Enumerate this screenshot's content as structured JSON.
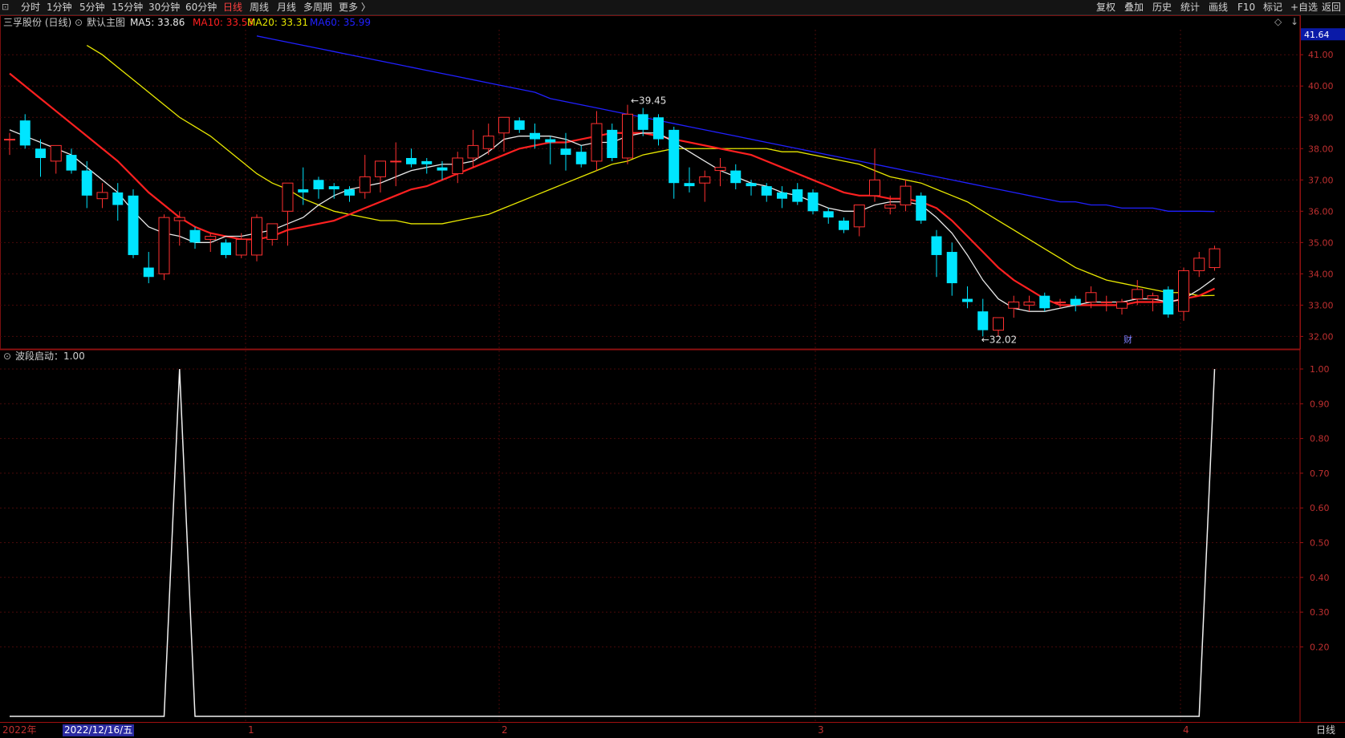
{
  "toolbar": {
    "left_items": [
      "分时",
      "1分钟",
      "5分钟",
      "15分钟",
      "30分钟",
      "60分钟",
      "日线",
      "周线",
      "月线",
      "多周期",
      "更多 〉"
    ],
    "active_item": "日线",
    "right_items": [
      "复权",
      "叠加",
      "历史",
      "统计",
      "画线",
      "F10",
      "标记",
      "+自选",
      "返回"
    ]
  },
  "main_panel": {
    "stock_title": "三孚股份 (日线)",
    "indicator_name": "默认主图",
    "ma": [
      {
        "label": "MA5: 33.86",
        "color": "#e8e8e8"
      },
      {
        "label": "MA10: 33.53",
        "color": "#ff2020"
      },
      {
        "label": "MA20: 33.31",
        "color": "#e8e800"
      },
      {
        "label": "MA60: 35.99",
        "color": "#2020ff"
      }
    ],
    "price_ticks": [
      "41.00",
      "40.00",
      "39.00",
      "38.00",
      "37.00",
      "36.00",
      "35.00",
      "34.00",
      "33.00",
      "32.00"
    ],
    "current_price_label": "41.64",
    "high_annotation": "39.45",
    "low_annotation": "32.02",
    "event_marker": "财",
    "right_icons": [
      "◇",
      "↓"
    ]
  },
  "sub_panel": {
    "indicator_label": "波段启动：1.00",
    "ticks": [
      "1.00",
      "0.90",
      "0.80",
      "0.70",
      "0.60",
      "0.50",
      "0.40",
      "0.30",
      "0.20"
    ]
  },
  "x_axis": {
    "year_label": "2022年",
    "cursor_date": "2022/12/16/五",
    "month_labels": [
      "1",
      "2",
      "3",
      "4"
    ],
    "period_label": "日线"
  },
  "colors": {
    "up": "#ff3030",
    "down": "#00e5ff",
    "grid": "#4a0a0a",
    "axis_text": "#c03030",
    "ma5": "#e8e8e8",
    "ma10": "#ff2020",
    "ma20": "#e8e800",
    "ma60": "#2020ff"
  },
  "chart_data": {
    "type": "candlestick",
    "y_range": [
      31.6,
      41.8
    ],
    "candles_ohlc": [
      [
        38.3,
        38.5,
        37.8,
        38.3
      ],
      [
        38.9,
        39.1,
        38.0,
        38.1
      ],
      [
        38.0,
        38.3,
        37.1,
        37.7
      ],
      [
        37.6,
        38.1,
        37.2,
        38.1
      ],
      [
        37.8,
        38.0,
        37.2,
        37.3
      ],
      [
        37.3,
        37.6,
        36.1,
        36.5
      ],
      [
        36.4,
        36.9,
        36.1,
        36.6
      ],
      [
        36.6,
        36.9,
        35.7,
        36.2
      ],
      [
        36.5,
        36.7,
        34.5,
        34.6
      ],
      [
        34.2,
        34.7,
        33.7,
        33.9
      ],
      [
        34.0,
        35.9,
        33.8,
        35.8
      ],
      [
        35.7,
        36.0,
        34.9,
        35.8
      ],
      [
        35.4,
        35.5,
        34.8,
        35.0
      ],
      [
        35.1,
        35.3,
        34.7,
        35.2
      ],
      [
        35.0,
        35.1,
        34.5,
        34.6
      ],
      [
        34.6,
        35.3,
        34.5,
        35.1
      ],
      [
        34.6,
        35.9,
        34.4,
        35.8
      ],
      [
        35.1,
        35.6,
        34.9,
        35.6
      ],
      [
        36.0,
        36.4,
        34.9,
        36.9
      ],
      [
        36.7,
        37.4,
        36.2,
        36.6
      ],
      [
        37.0,
        37.1,
        36.4,
        36.7
      ],
      [
        36.8,
        36.9,
        36.4,
        36.7
      ],
      [
        36.7,
        36.8,
        36.3,
        36.5
      ],
      [
        36.6,
        37.8,
        36.4,
        37.1
      ],
      [
        37.1,
        37.6,
        36.6,
        37.6
      ],
      [
        37.6,
        38.2,
        36.8,
        37.6
      ],
      [
        37.7,
        38.0,
        37.4,
        37.5
      ],
      [
        37.6,
        37.7,
        37.2,
        37.5
      ],
      [
        37.4,
        37.6,
        37.0,
        37.3
      ],
      [
        37.2,
        37.9,
        36.9,
        37.7
      ],
      [
        37.7,
        38.6,
        37.4,
        38.1
      ],
      [
        38.0,
        38.8,
        37.8,
        38.4
      ],
      [
        38.5,
        39.0,
        37.9,
        39.0
      ],
      [
        38.9,
        39.0,
        38.5,
        38.6
      ],
      [
        38.5,
        38.8,
        38.0,
        38.3
      ],
      [
        38.3,
        38.4,
        37.5,
        38.2
      ],
      [
        38.0,
        38.5,
        37.3,
        37.8
      ],
      [
        37.9,
        38.1,
        37.4,
        37.5
      ],
      [
        37.6,
        39.2,
        37.3,
        38.8
      ],
      [
        38.6,
        38.8,
        37.6,
        37.7
      ],
      [
        37.7,
        39.4,
        37.5,
        39.1
      ],
      [
        39.1,
        39.3,
        38.4,
        38.6
      ],
      [
        39.0,
        39.1,
        38.1,
        38.3
      ],
      [
        38.6,
        38.7,
        36.4,
        36.9
      ],
      [
        36.9,
        37.4,
        36.6,
        36.8
      ],
      [
        36.9,
        37.3,
        36.3,
        37.1
      ],
      [
        37.3,
        37.7,
        36.8,
        37.4
      ],
      [
        37.3,
        37.5,
        36.7,
        36.9
      ],
      [
        36.9,
        37.0,
        36.5,
        36.8
      ],
      [
        36.8,
        36.9,
        36.3,
        36.5
      ],
      [
        36.6,
        36.8,
        36.1,
        36.4
      ],
      [
        36.7,
        36.9,
        36.2,
        36.3
      ],
      [
        36.6,
        36.7,
        35.9,
        36.0
      ],
      [
        36.0,
        36.1,
        35.6,
        35.8
      ],
      [
        35.7,
        35.8,
        35.3,
        35.4
      ],
      [
        35.5,
        36.2,
        35.2,
        36.2
      ],
      [
        36.5,
        38.0,
        36.3,
        37.0
      ],
      [
        36.1,
        36.5,
        35.9,
        36.2
      ],
      [
        36.2,
        37.0,
        36.0,
        36.8
      ],
      [
        36.5,
        36.6,
        35.6,
        35.7
      ],
      [
        35.2,
        35.4,
        33.9,
        34.6
      ],
      [
        34.7,
        35.0,
        33.3,
        33.7
      ],
      [
        33.2,
        33.6,
        32.9,
        33.1
      ],
      [
        32.8,
        33.2,
        32.0,
        32.2
      ],
      [
        32.2,
        32.6,
        32.0,
        32.6
      ],
      [
        32.9,
        33.3,
        32.6,
        33.1
      ],
      [
        33.0,
        33.3,
        32.8,
        33.1
      ],
      [
        33.3,
        33.4,
        32.8,
        32.9
      ],
      [
        33.1,
        33.2,
        32.9,
        33.1
      ],
      [
        33.2,
        33.3,
        32.8,
        33.0
      ],
      [
        33.1,
        33.6,
        32.9,
        33.4
      ],
      [
        33.1,
        33.3,
        32.8,
        33.1
      ],
      [
        32.9,
        33.2,
        32.7,
        33.1
      ],
      [
        33.2,
        33.8,
        33.0,
        33.5
      ],
      [
        33.2,
        33.4,
        32.8,
        33.3
      ],
      [
        33.5,
        33.6,
        32.6,
        32.7
      ],
      [
        32.8,
        34.2,
        32.5,
        34.1
      ],
      [
        34.1,
        34.7,
        33.9,
        34.5
      ],
      [
        34.2,
        34.9,
        34.1,
        34.8
      ]
    ],
    "ma5": [
      38.6,
      38.4,
      38.2,
      38.0,
      37.8,
      37.4,
      37.0,
      36.6,
      36.0,
      35.5,
      35.3,
      35.2,
      35.0,
      35.0,
      35.2,
      35.2,
      35.3,
      35.4,
      35.6,
      35.8,
      36.2,
      36.5,
      36.7,
      36.8,
      36.9,
      37.1,
      37.3,
      37.4,
      37.5,
      37.5,
      37.6,
      37.9,
      38.3,
      38.4,
      38.4,
      38.4,
      38.3,
      38.1,
      38.2,
      38.2,
      38.4,
      38.5,
      38.5,
      38.2,
      37.9,
      37.6,
      37.3,
      37.1,
      36.9,
      36.8,
      36.6,
      36.5,
      36.3,
      36.1,
      36.0,
      36.0,
      36.2,
      36.3,
      36.3,
      36.2,
      35.8,
      35.3,
      34.6,
      33.8,
      33.2,
      32.9,
      32.8,
      32.8,
      32.9,
      33.0,
      33.1,
      33.1,
      33.1,
      33.2,
      33.2,
      33.1,
      33.2,
      33.5,
      33.86
    ],
    "ma10": [
      40.4,
      40.0,
      39.6,
      39.2,
      38.8,
      38.4,
      38.0,
      37.6,
      37.1,
      36.6,
      36.2,
      35.8,
      35.5,
      35.3,
      35.2,
      35.1,
      35.1,
      35.2,
      35.4,
      35.5,
      35.6,
      35.7,
      35.9,
      36.1,
      36.3,
      36.5,
      36.7,
      36.8,
      37.0,
      37.2,
      37.4,
      37.6,
      37.8,
      38.0,
      38.1,
      38.2,
      38.2,
      38.3,
      38.4,
      38.5,
      38.5,
      38.5,
      38.4,
      38.3,
      38.2,
      38.1,
      38.0,
      37.9,
      37.8,
      37.6,
      37.4,
      37.2,
      37.0,
      36.8,
      36.6,
      36.5,
      36.5,
      36.4,
      36.4,
      36.3,
      36.1,
      35.7,
      35.2,
      34.7,
      34.2,
      33.8,
      33.5,
      33.2,
      33.0,
      33.0,
      33.0,
      33.0,
      33.0,
      33.1,
      33.1,
      33.1,
      33.2,
      33.3,
      33.53
    ],
    "ma20": [
      41.3,
      41.0,
      40.6,
      40.2,
      39.8,
      39.4,
      39.0,
      38.7,
      38.4,
      38.0,
      37.6,
      37.2,
      36.9,
      36.7,
      36.4,
      36.2,
      36.0,
      35.9,
      35.8,
      35.7,
      35.7,
      35.6,
      35.6,
      35.6,
      35.7,
      35.8,
      35.9,
      36.1,
      36.3,
      36.5,
      36.7,
      36.9,
      37.1,
      37.3,
      37.5,
      37.6,
      37.8,
      37.9,
      38.0,
      38.0,
      38.0,
      38.0,
      38.0,
      38.0,
      38.0,
      37.9,
      37.9,
      37.8,
      37.7,
      37.6,
      37.5,
      37.3,
      37.1,
      37.0,
      36.9,
      36.7,
      36.5,
      36.3,
      36.0,
      35.7,
      35.4,
      35.1,
      34.8,
      34.5,
      34.2,
      34.0,
      33.8,
      33.7,
      33.6,
      33.5,
      33.4,
      33.4,
      33.3,
      33.31
    ],
    "ma60": [
      41.6,
      41.5,
      41.4,
      41.3,
      41.2,
      41.1,
      41.0,
      40.9,
      40.8,
      40.7,
      40.6,
      40.5,
      40.4,
      40.3,
      40.2,
      40.1,
      40.0,
      39.9,
      39.8,
      39.6,
      39.5,
      39.4,
      39.3,
      39.2,
      39.1,
      39.0,
      38.9,
      38.8,
      38.7,
      38.6,
      38.5,
      38.4,
      38.3,
      38.2,
      38.1,
      38.0,
      37.9,
      37.8,
      37.7,
      37.6,
      37.5,
      37.4,
      37.3,
      37.2,
      37.1,
      37.0,
      36.9,
      36.8,
      36.7,
      36.6,
      36.5,
      36.4,
      36.3,
      36.3,
      36.2,
      36.2,
      36.1,
      36.1,
      36.1,
      36.0,
      36.0,
      36.0,
      35.99
    ],
    "signal": [
      0,
      0,
      0,
      0,
      0,
      0,
      0,
      0,
      0,
      0,
      0,
      1,
      0,
      0,
      0,
      0,
      0,
      0,
      0,
      0,
      0,
      0,
      0,
      0,
      0,
      0,
      0,
      0,
      0,
      0,
      0,
      0,
      0,
      0,
      0,
      0,
      0,
      0,
      0,
      0,
      0,
      0,
      0,
      0,
      0,
      0,
      0,
      0,
      0,
      0,
      0,
      0,
      0,
      0,
      0,
      0,
      0,
      0,
      0,
      0,
      0,
      0,
      0,
      0,
      0,
      0,
      0,
      0,
      0,
      0,
      0,
      0,
      0,
      0,
      0,
      0,
      0,
      0,
      1
    ]
  }
}
